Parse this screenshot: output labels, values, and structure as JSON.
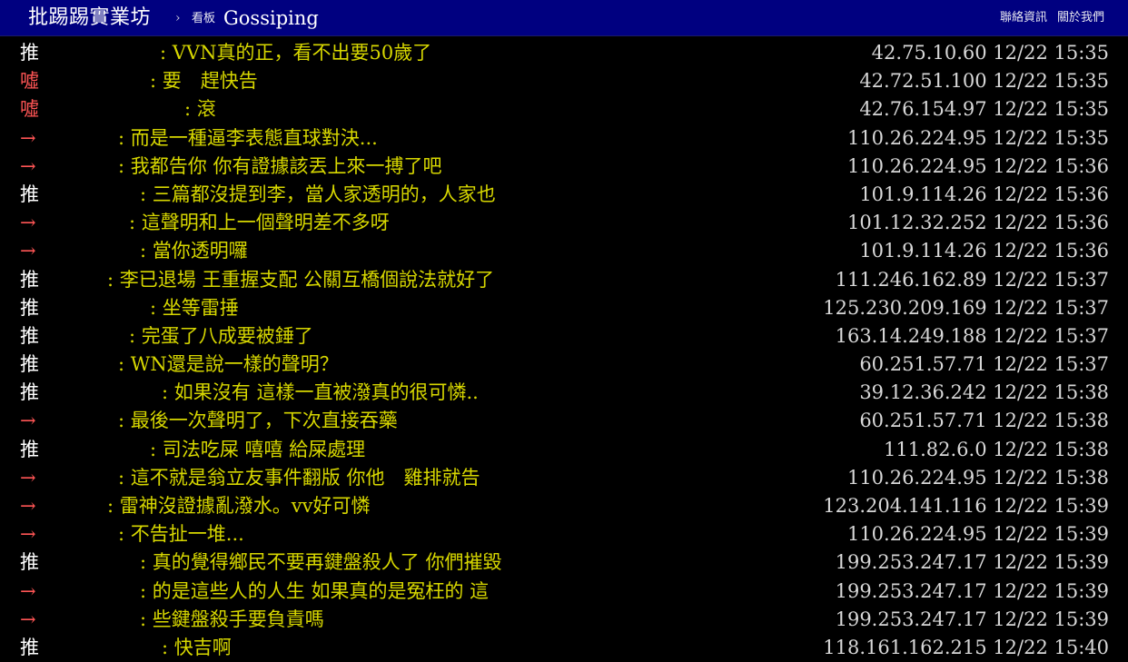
{
  "header": {
    "site_title": "批踢踢實業坊",
    "separator": "›",
    "board_label": "看板",
    "board_name": "Gossiping",
    "links": [
      "聯絡資訊",
      "關於我們"
    ]
  },
  "colors": {
    "header_bg": "#000080",
    "page_bg": "#000000",
    "push_tag": "#ffffff",
    "boo_tag": "#ff5555",
    "arrow_tag": "#ff5555",
    "content_text": "#d7d700",
    "meta_text": "#d8d8d8"
  },
  "pushes": [
    {
      "type": "push",
      "tag": "推",
      "content": "VVN真的正，看不出要50歲了",
      "ip": "42.75.10.60",
      "time": "12/22 15:35"
    },
    {
      "type": "boo",
      "tag": "噓",
      "content": "要　趕快告",
      "ip": "42.72.51.100",
      "time": "12/22 15:35"
    },
    {
      "type": "boo",
      "tag": "噓",
      "content": "滾",
      "ip": "42.76.154.97",
      "time": "12/22 15:35"
    },
    {
      "type": "arrow",
      "tag": "→",
      "content": "而是一種逼李表態直球對決...",
      "ip": "110.26.224.95",
      "time": "12/22 15:35"
    },
    {
      "type": "arrow",
      "tag": "→",
      "content": "我都告你 你有證據該丟上來一搏了吧",
      "ip": "110.26.224.95",
      "time": "12/22 15:36"
    },
    {
      "type": "push",
      "tag": "推",
      "content": "三篇都沒提到李，當人家透明的，人家也",
      "ip": "101.9.114.26",
      "time": "12/22 15:36"
    },
    {
      "type": "arrow",
      "tag": "→",
      "content": "這聲明和上一個聲明差不多呀",
      "ip": "101.12.32.252",
      "time": "12/22 15:36"
    },
    {
      "type": "arrow",
      "tag": "→",
      "content": "當你透明囉",
      "ip": "101.9.114.26",
      "time": "12/22 15:36"
    },
    {
      "type": "push",
      "tag": "推",
      "content": "李已退場 王重握支配 公關互橋個說法就好了",
      "ip": "111.246.162.89",
      "time": "12/22 15:37"
    },
    {
      "type": "push",
      "tag": "推",
      "content": "坐等雷捶",
      "ip": "125.230.209.169",
      "time": "12/22 15:37"
    },
    {
      "type": "push",
      "tag": "推",
      "content": "完蛋了八成要被錘了",
      "ip": "163.14.249.188",
      "time": "12/22 15:37"
    },
    {
      "type": "push",
      "tag": "推",
      "content": "WN還是說一樣的聲明？",
      "ip": "60.251.57.71",
      "time": "12/22 15:37"
    },
    {
      "type": "push",
      "tag": "推",
      "content": "如果沒有 這樣一直被潑真的很可憐..",
      "ip": "39.12.36.242",
      "time": "12/22 15:38"
    },
    {
      "type": "arrow",
      "tag": "→",
      "content": "最後一次聲明了，下次直接吞藥",
      "ip": "60.251.57.71",
      "time": "12/22 15:38"
    },
    {
      "type": "push",
      "tag": "推",
      "content": "司法吃屎 嘻嘻 給屎處理",
      "ip": "111.82.6.0",
      "time": "12/22 15:38"
    },
    {
      "type": "arrow",
      "tag": "→",
      "content": "這不就是翁立友事件翻版 你他　雞排就告",
      "ip": "110.26.224.95",
      "time": "12/22 15:38"
    },
    {
      "type": "arrow",
      "tag": "→",
      "content": "雷神沒證據亂潑水。vv好可憐",
      "ip": "123.204.141.116",
      "time": "12/22 15:39"
    },
    {
      "type": "arrow",
      "tag": "→",
      "content": "不告扯一堆...",
      "ip": "110.26.224.95",
      "time": "12/22 15:39"
    },
    {
      "type": "push",
      "tag": "推",
      "content": "真的覺得鄉民不要再鍵盤殺人了 你們摧毀",
      "ip": "199.253.247.17",
      "time": "12/22 15:39"
    },
    {
      "type": "arrow",
      "tag": "→",
      "content": "的是這些人的人生 如果真的是冤枉的 這",
      "ip": "199.253.247.17",
      "time": "12/22 15:39"
    },
    {
      "type": "arrow",
      "tag": "→",
      "content": "些鍵盤殺手要負責嗎",
      "ip": "199.253.247.17",
      "time": "12/22 15:39"
    },
    {
      "type": "push",
      "tag": "推",
      "content": "快吉啊",
      "ip": "118.161.162.215",
      "time": "12/22 15:40"
    }
  ]
}
